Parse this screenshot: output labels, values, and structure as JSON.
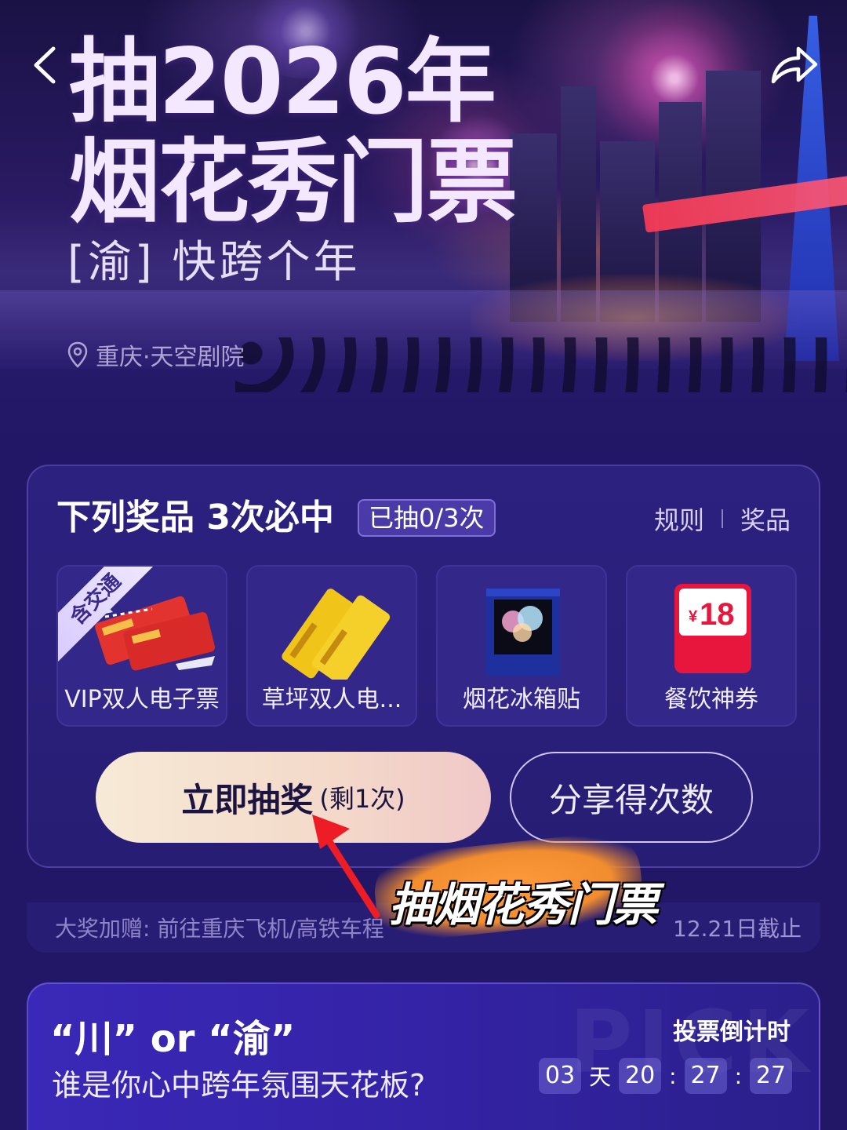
{
  "hero": {
    "title_line1": "抽2026年",
    "title_line2": "烟花秀门票",
    "subtitle": "[渝] 快跨个年",
    "location": "重庆·天空剧院"
  },
  "prize_card": {
    "heading": "下列奖品 3次必中",
    "drawn_badge": "已抽0/3次",
    "rules_link": "规则",
    "prizes_link": "奖品",
    "prizes": [
      {
        "name": "VIP双人电子票",
        "badge": "含交通",
        "icon": "train-ticket-icon"
      },
      {
        "name": "草坪双人电...",
        "icon": "yellow-ticket-icon"
      },
      {
        "name": "烟花冰箱贴",
        "icon": "fridge-magnet-icon"
      },
      {
        "name": "餐饮神券",
        "coupon_value": "18",
        "coupon_currency": "¥",
        "icon": "coupon-icon"
      }
    ],
    "draw_button": "立即抽奖",
    "draw_remaining": "(剩1次)",
    "share_button": "分享得次数",
    "note_left": "大奖加赠: 前往重庆飞机/高铁车程",
    "note_right": "12.21日截止"
  },
  "annotation": {
    "caption": "抽烟花秀门票"
  },
  "vote_card": {
    "watermark": "PICK",
    "title": "“川” or “渝”",
    "subtitle": "谁是你心中跨年氛围天花板?",
    "countdown_label": "投票倒计时",
    "days": "03",
    "days_unit": "天",
    "hours": "20",
    "minutes": "27",
    "seconds": "27"
  },
  "colors": {
    "background": "#211766",
    "card": "#2d2180",
    "draw_button_start": "#f6ead6",
    "highlight": "#f28d2f"
  }
}
